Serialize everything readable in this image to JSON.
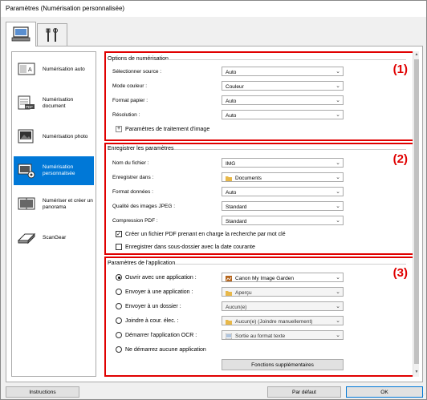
{
  "window": {
    "title": "Paramètres (Numérisation personnalisée)"
  },
  "tabs": [
    {
      "icon": "scan-settings-icon",
      "active": true
    },
    {
      "icon": "general-settings-icon",
      "active": false
    }
  ],
  "sidebar": {
    "items": [
      {
        "label": "Numérisation auto",
        "icon": "auto-scan-icon",
        "selected": false
      },
      {
        "label": "Numérisation document",
        "icon": "document-scan-icon",
        "selected": false
      },
      {
        "label": "Numérisation photo",
        "icon": "photo-scan-icon",
        "selected": false
      },
      {
        "label": "Numérisation personnalisée",
        "icon": "custom-scan-icon",
        "selected": true
      },
      {
        "label": "Numériser et créer un panorama",
        "icon": "panorama-icon",
        "selected": false
      },
      {
        "label": "ScanGear",
        "icon": "scangear-icon",
        "selected": false
      }
    ]
  },
  "scan_options": {
    "title": "Options de numérisation",
    "number": "(1)",
    "rows": [
      {
        "label": "Sélectionner source :",
        "value": "Auto"
      },
      {
        "label": "Mode couleur :",
        "value": "Couleur"
      },
      {
        "label": "Format papier :",
        "value": "Auto"
      },
      {
        "label": "Résolution :",
        "value": "Auto"
      }
    ],
    "expander_label": "Paramètres de traitement d'image",
    "expander_symbol": "+"
  },
  "save_settings": {
    "title": "Enregistrer les paramètres",
    "number": "(2)",
    "rows": [
      {
        "label": "Nom du fichier :",
        "value": "IMG"
      },
      {
        "label": "Enregistrer dans :",
        "value": "Documents",
        "icon": "folder-icon"
      },
      {
        "label": "Format données :",
        "value": "Auto"
      },
      {
        "label": "Qualité des images JPEG :",
        "value": "Standard"
      },
      {
        "label": "Compression PDF :",
        "value": "Standard"
      }
    ],
    "checkbox1": {
      "label": "Créer un fichier PDF prenant en charge la recherche par mot clé",
      "checked": true,
      "mark": "✓"
    },
    "checkbox2": {
      "label": "Enregistrer dans sous-dossier avec la date courante",
      "checked": false
    }
  },
  "app_settings": {
    "title": "Paramètres de l'application",
    "number": "(3)",
    "options": [
      {
        "label": "Ouvrir avec une application :",
        "value": "Canon My Image Garden",
        "selected": true,
        "enabled": true,
        "icon": "image-garden-icon"
      },
      {
        "label": "Envoyer à une application :",
        "value": "Aperçu",
        "selected": false,
        "enabled": false,
        "icon": "folder-icon"
      },
      {
        "label": "Envoyer à un dossier :",
        "value": "Aucun(e)",
        "selected": false,
        "enabled": false
      },
      {
        "label": "Joindre à cour. élec. :",
        "value": "Aucun(e) (Joindre manuellement)",
        "selected": false,
        "enabled": false,
        "icon": "folder-icon"
      },
      {
        "label": "Démarrer l'application OCR :",
        "value": "Sortie au format texte",
        "selected": false,
        "enabled": false,
        "icon": "ocr-icon"
      }
    ],
    "no_app_label": "Ne démarrez aucune application",
    "more_functions_label": "Fonctions supplémentaires"
  },
  "footer": {
    "instructions_label": "Instructions",
    "default_label": "Par défaut",
    "ok_label": "OK"
  },
  "colors": {
    "highlight": "#e00000",
    "selection": "#0078d7"
  }
}
